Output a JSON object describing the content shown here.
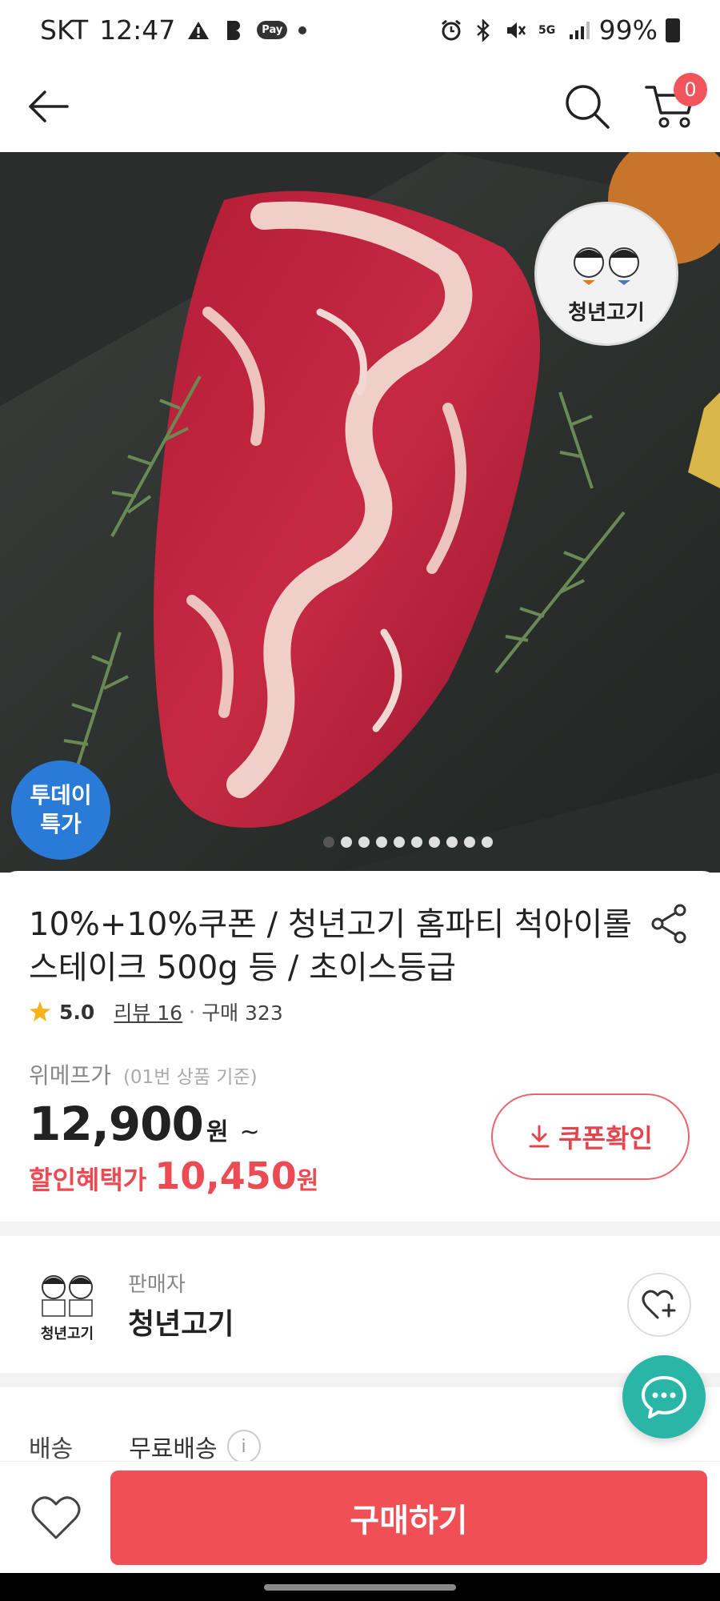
{
  "status_bar": {
    "carrier": "SKT",
    "time": "12:47",
    "pay_label": "Pay",
    "network": "5G",
    "battery": "99%",
    "icons": [
      "warning-icon",
      "b-icon",
      "pay-icon",
      "alarm-icon",
      "bluetooth-icon",
      "mute-icon",
      "signal-icon",
      "battery-icon"
    ]
  },
  "header": {
    "cart_count": "0",
    "icons": [
      "back-arrow-icon",
      "search-icon",
      "cart-icon"
    ]
  },
  "hero": {
    "badge_line1": "투데이",
    "badge_line2": "특가",
    "stamp_text": "청년고기",
    "image_count": 10,
    "active_index": 0
  },
  "product": {
    "title": "10%+10%쿠폰 / 청년고기 홈파티 척아이롤 스테이크 500g 등 / 초이스등급",
    "rating": "5.0",
    "review_label": "리뷰 16",
    "purchase_label": "구매 323",
    "price_label": "위메프가",
    "price_sub": "(01번 상품 기준)",
    "price": "12,900",
    "price_unit": "원",
    "price_tilde": "~",
    "sale_label": "할인혜택가",
    "sale_price": "10,450",
    "sale_unit": "원",
    "coupon_button": "쿠폰확인"
  },
  "seller": {
    "label": "판매자",
    "name": "청년고기",
    "logo_text": "청년고기"
  },
  "shipping": {
    "label": "배송",
    "value": "무료배송",
    "info": "i"
  },
  "bottom_bar": {
    "buy_button": "구매하기"
  },
  "colors": {
    "accent": "#ef4f55",
    "sale": "#ec4b53",
    "chat": "#2ab6a6",
    "badge_blue": "#2a7ad8"
  }
}
